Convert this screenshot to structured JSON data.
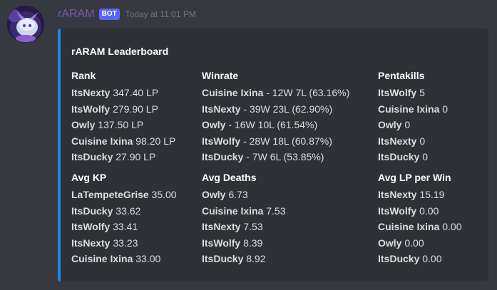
{
  "message": {
    "username": "rARAM",
    "bot_tag": "BOT",
    "timestamp": "Today at 11:01 PM",
    "accent_color": "#1e88e5"
  },
  "embed": {
    "title": "rARAM Leaderboard",
    "fields": [
      {
        "name": "Rank",
        "lines": [
          {
            "player": "ItsNexty",
            "value": " 347.40 LP"
          },
          {
            "player": "ItsWolfy",
            "value": " 279.90 LP"
          },
          {
            "player": "Owly",
            "value": " 137.50 LP"
          },
          {
            "player": "Cuisine Ixina",
            "value": " 98.20 LP"
          },
          {
            "player": "ItsDucky",
            "value": " 27.90 LP"
          }
        ]
      },
      {
        "name": "Winrate",
        "lines": [
          {
            "player": "Cuisine Ixina",
            "value": " - 12W 7L (63.16%)"
          },
          {
            "player": "ItsNexty",
            "value": " - 39W 23L (62.90%)"
          },
          {
            "player": "Owly",
            "value": " - 16W 10L (61.54%)"
          },
          {
            "player": "ItsWolfy",
            "value": " - 28W 18L (60.87%)"
          },
          {
            "player": "ItsDucky",
            "value": " - 7W 6L (53.85%)"
          }
        ]
      },
      {
        "name": "Pentakills",
        "lines": [
          {
            "player": "ItsWolfy",
            "value": " 5"
          },
          {
            "player": "Cuisine Ixina",
            "value": " 0"
          },
          {
            "player": "Owly",
            "value": " 0"
          },
          {
            "player": "ItsNexty",
            "value": " 0"
          },
          {
            "player": "ItsDucky",
            "value": " 0"
          }
        ]
      },
      {
        "name": "Avg KP",
        "lines": [
          {
            "player": "LaTempeteGrise",
            "value": " 35.00"
          },
          {
            "player": "ItsDucky",
            "value": " 33.62"
          },
          {
            "player": "ItsWolfy",
            "value": " 33.41"
          },
          {
            "player": "ItsNexty",
            "value": " 33.23"
          },
          {
            "player": "Cuisine Ixina",
            "value": " 33.00"
          }
        ]
      },
      {
        "name": "Avg Deaths",
        "lines": [
          {
            "player": "Owly",
            "value": " 6.73"
          },
          {
            "player": "Cuisine Ixina",
            "value": " 7.53"
          },
          {
            "player": "ItsNexty",
            "value": " 7.53"
          },
          {
            "player": "ItsWolfy",
            "value": " 8.39"
          },
          {
            "player": "ItsDucky",
            "value": " 8.92"
          }
        ]
      },
      {
        "name": "Avg LP per Win",
        "lines": [
          {
            "player": "ItsNexty",
            "value": " 15.19"
          },
          {
            "player": "ItsWolfy",
            "value": " 0.00"
          },
          {
            "player": "Cuisine Ixina",
            "value": " 0.00"
          },
          {
            "player": "Owly",
            "value": " 0.00"
          },
          {
            "player": "ItsDucky",
            "value": " 0.00"
          }
        ]
      }
    ]
  }
}
